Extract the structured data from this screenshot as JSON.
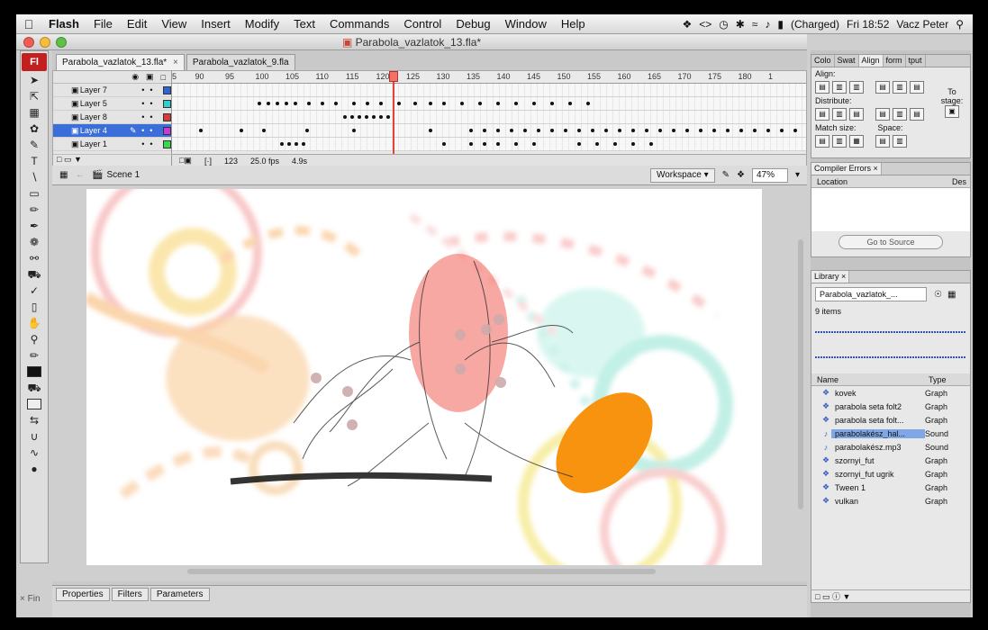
{
  "menubar": {
    "items": [
      "Flash",
      "File",
      "Edit",
      "View",
      "Insert",
      "Modify",
      "Text",
      "Commands",
      "Control",
      "Debug",
      "Window",
      "Help"
    ],
    "battery": "(Charged)",
    "clock": "Fri 18:52",
    "user": "Vacz Peter"
  },
  "window": {
    "title": "Parabola_vazlatok_13.fla*"
  },
  "toolbox": {
    "logo": "Fl"
  },
  "doc_tabs": [
    {
      "label": "Parabola_vazlatok_13.fla*",
      "close": "×"
    },
    {
      "label": "Parabola_vazlatok_9.fla",
      "close": ""
    }
  ],
  "timeline": {
    "ruler_ticks": [
      "5",
      "90",
      "95",
      "100",
      "105",
      "110",
      "115",
      "120",
      "125",
      "130",
      "135",
      "140",
      "145",
      "150",
      "155",
      "160",
      "165",
      "170",
      "175",
      "180",
      "1"
    ],
    "layers": [
      {
        "name": "Layer 7",
        "color": "#2f64d4",
        "selected": false
      },
      {
        "name": "Layer 5",
        "color": "#2fcfcf",
        "selected": false
      },
      {
        "name": "Layer 8",
        "color": "#d83a3a",
        "selected": false
      },
      {
        "name": "Layer 4",
        "color": "#c43ad8",
        "selected": true
      },
      {
        "name": "Layer 1",
        "color": "#3ad84a",
        "selected": false
      }
    ],
    "current_frame": "123",
    "fps": "25.0 fps",
    "elapsed": "4.9s"
  },
  "editbar": {
    "scene": "Scene 1",
    "workspace": "Workspace ▾",
    "zoom": "47%"
  },
  "properties": {
    "tabs": [
      "Properties",
      "Filters",
      "Parameters"
    ]
  },
  "align_panel": {
    "tabs": [
      "Colo",
      "Swat",
      "Align",
      "form",
      "tput"
    ],
    "align_label": "Align:",
    "distribute_label": "Distribute:",
    "match_size_label": "Match size:",
    "space_label": "Space:",
    "to_stage_label": "To stage:"
  },
  "compiler_errors": {
    "tab": "Compiler Errors",
    "col_location": "Location",
    "col_desc": "Des",
    "goto_source": "Go to Source"
  },
  "library": {
    "tab": "Library",
    "file": "Parabola_vazlatok_...",
    "count": "9 items",
    "col_name": "Name",
    "col_type": "Type",
    "items": [
      {
        "name": "kovek",
        "type": "Graph",
        "icon": "graphic-icon",
        "selected": false
      },
      {
        "name": "parabola seta folt2",
        "type": "Graph",
        "icon": "graphic-icon",
        "selected": false
      },
      {
        "name": "parabola seta folt...",
        "type": "Graph",
        "icon": "graphic-icon",
        "selected": false
      },
      {
        "name": "parabolakész_hal...",
        "type": "Sound",
        "icon": "sound-icon",
        "selected": true
      },
      {
        "name": "parabolakész.mp3",
        "type": "Sound",
        "icon": "sound-icon",
        "selected": false
      },
      {
        "name": "szornyi_fut",
        "type": "Graph",
        "icon": "graphic-icon",
        "selected": false
      },
      {
        "name": "szornyi_fut ugrik",
        "type": "Graph",
        "icon": "graphic-icon",
        "selected": false
      },
      {
        "name": "Tween 1",
        "type": "Graph",
        "icon": "graphic-icon",
        "selected": false
      },
      {
        "name": "vulkan",
        "type": "Graph",
        "icon": "graphic-icon",
        "selected": false
      }
    ]
  },
  "dock": {
    "partial_label": "Fin"
  }
}
